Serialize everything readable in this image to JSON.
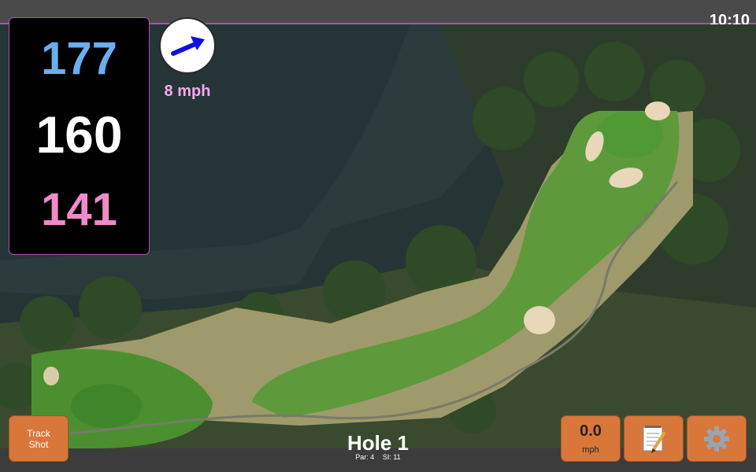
{
  "status": {
    "time": "10:10"
  },
  "distances": {
    "back": "177",
    "middle": "160",
    "front": "141",
    "back_color": "#6aaef0",
    "middle_color": "#ffffff",
    "front_color": "#f08ac8"
  },
  "wind": {
    "speed": "8 mph",
    "icon": "wind-arrow-icon",
    "color": "#f6a8f0",
    "arrow_color": "#1010e0"
  },
  "buttons": {
    "track_shot_line1": "Track",
    "track_shot_line2": "Shot",
    "speed_value": "0.0",
    "speed_unit": "mph",
    "notes_icon": "notepad-icon",
    "settings_icon": "gear-icon"
  },
  "hole": {
    "title": "Hole 1",
    "par": "Par: 4",
    "si": "SI: 11"
  }
}
